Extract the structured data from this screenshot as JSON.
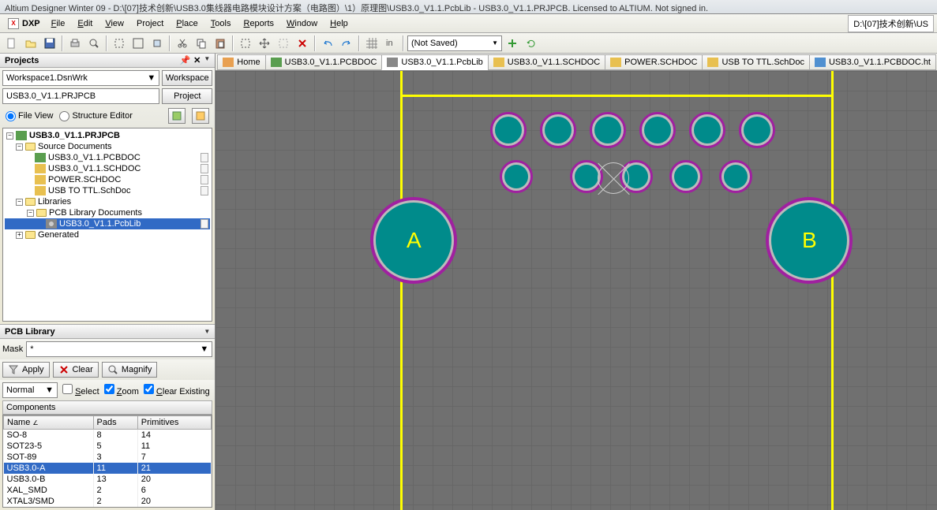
{
  "title": "Altium Designer Winter 09 - D:\\[07]技术创新\\USB3.0集线器电路模块设计方案（电路图）\\1）原理图\\USB3.0_V1.1.PcbLib - USB3.0_V1.1.PRJPCB. Licensed to ALTIUM. Not signed in.",
  "path_box": "D:\\[07]技术创新\\US",
  "menu": {
    "dxp": "DXP",
    "file": "File",
    "edit": "Edit",
    "view": "View",
    "project": "Project",
    "place": "Place",
    "tools": "Tools",
    "reports": "Reports",
    "window": "Window",
    "help": "Help"
  },
  "toolbar": {
    "not_saved": "(Not Saved)"
  },
  "projects": {
    "title": "Projects",
    "workspace_combo": "Workspace1.DsnWrk",
    "workspace_btn": "Workspace",
    "project_combo": "USB3.0_V1.1.PRJPCB",
    "project_btn": "Project",
    "file_view": "File View",
    "structure_editor": "Structure Editor"
  },
  "tree": {
    "root": "USB3.0_V1.1.PRJPCB",
    "source_docs": "Source Documents",
    "files": [
      "USB3.0_V1.1.PCBDOC",
      "USB3.0_V1.1.SCHDOC",
      "POWER.SCHDOC",
      "USB TO TTL.SchDoc"
    ],
    "libraries": "Libraries",
    "pcb_lib_docs": "PCB Library Documents",
    "pcblib_file": "USB3.0_V1.1.PcbLib",
    "generated": "Generated"
  },
  "pcblib": {
    "title": "PCB Library",
    "mask_label": "Mask",
    "mask_value": "*",
    "apply": "Apply",
    "clear": "Clear",
    "magnify": "Magnify",
    "normal": "Normal",
    "select": "Select",
    "zoom": "Zoom",
    "clear_existing": "Clear Existing"
  },
  "components": {
    "title": "Components",
    "cols": {
      "name": "Name",
      "pads": "Pads",
      "primitives": "Primitives"
    },
    "rows": [
      {
        "name": "SO-8",
        "pads": "8",
        "prim": "14"
      },
      {
        "name": "SOT23-5",
        "pads": "5",
        "prim": "11"
      },
      {
        "name": "SOT-89",
        "pads": "3",
        "prim": "7"
      },
      {
        "name": "USB3.0-A",
        "pads": "11",
        "prim": "21",
        "selected": true
      },
      {
        "name": "USB3.0-B",
        "pads": "13",
        "prim": "20"
      },
      {
        "name": "XAL_SMD",
        "pads": "2",
        "prim": "6"
      },
      {
        "name": "XTAL3/SMD",
        "pads": "2",
        "prim": "20"
      }
    ]
  },
  "tabs": [
    {
      "label": "Home",
      "icon": "home"
    },
    {
      "label": "USB3.0_V1.1.PCBDOC",
      "icon": "pcb"
    },
    {
      "label": "USB3.0_V1.1.PcbLib",
      "icon": "lib",
      "active": true
    },
    {
      "label": "USB3.0_V1.1.SCHDOC",
      "icon": "sch"
    },
    {
      "label": "POWER.SCHDOC",
      "icon": "sch"
    },
    {
      "label": "USB TO TTL.SchDoc",
      "icon": "sch"
    },
    {
      "label": "USB3.0_V1.1.PCBDOC.ht",
      "icon": "htm"
    }
  ],
  "pads": {
    "A": "A",
    "B": "B"
  }
}
